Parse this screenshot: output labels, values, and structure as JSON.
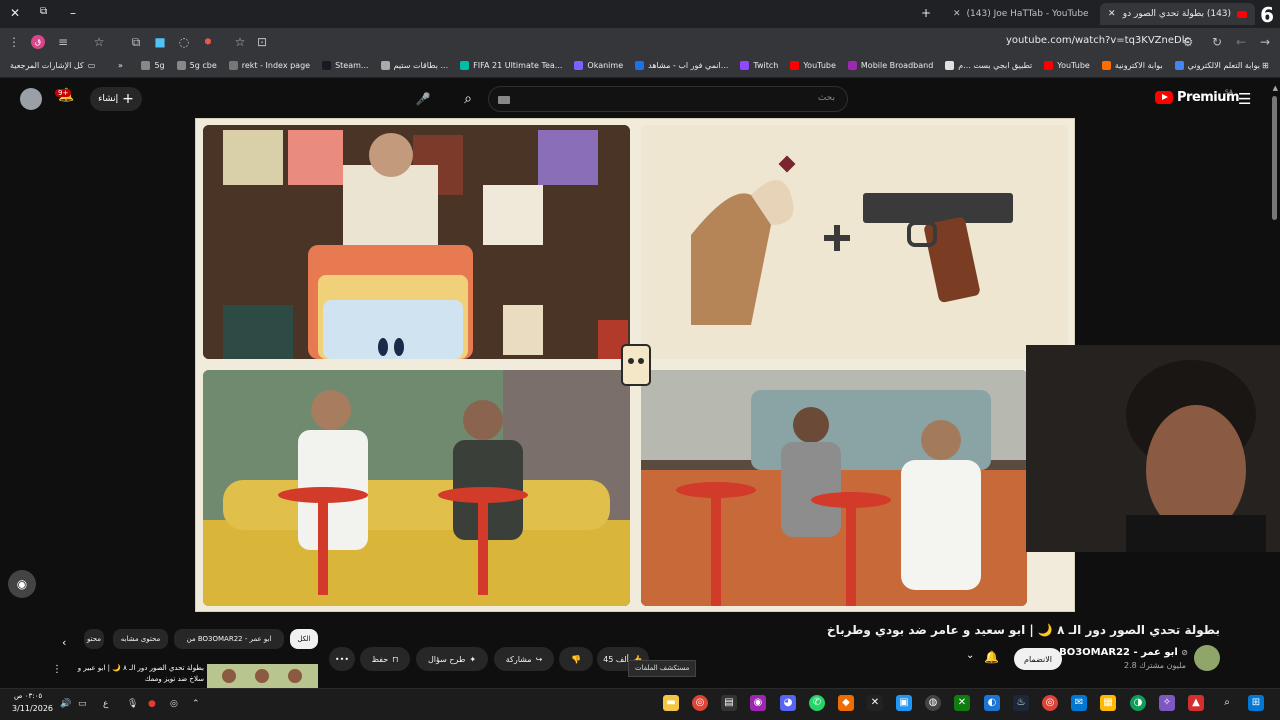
{
  "browser": {
    "tabs": [
      {
        "label": "(143) Joe HaTTab - YouTube",
        "active": false
      },
      {
        "label": "(143) بطولة تحدي الصور دو...",
        "active": true
      }
    ],
    "corner_badge": "6",
    "url": "youtube.com/watch?v=tq3KVZneDlc",
    "bookmarks": [
      {
        "label": "بوابة التعلم الالكتروني",
        "color": "#4285f4"
      },
      {
        "label": "بوابة الاكترونية",
        "color": "#ff6d00"
      },
      {
        "label": "YouTube",
        "color": "#ff0000"
      },
      {
        "label": "تطبيق ابجي بست ...م",
        "color": "#e0e0e0"
      },
      {
        "label": "Mobile Broadband",
        "color": "#9c27b0"
      },
      {
        "label": "YouTube",
        "color": "#ff0000"
      },
      {
        "label": "Twitch",
        "color": "#9146ff"
      },
      {
        "label": "انمي فور اب - مشاهد...",
        "color": "#1a73e8"
      },
      {
        "label": "Okanime",
        "color": "#7b61ff"
      },
      {
        "label": "FIFA 21 Ultimate Tea...",
        "color": "#00bfa5"
      },
      {
        "label": "بطاقات ستيم ...",
        "color": "#aaaaaa"
      },
      {
        "label": "Steam...",
        "color": "#171a21"
      },
      {
        "label": "rekt - Index page",
        "color": "#777777"
      },
      {
        "label": "5g cbe",
        "color": "#888888"
      },
      {
        "label": "5g",
        "color": "#888888"
      }
    ],
    "all_bookmarks": "كل الإشارات المرجعية"
  },
  "youtube": {
    "search_placeholder": "بحث",
    "create_label": "إنشاء",
    "notif_count": "9+",
    "logo": "Premium",
    "logo_region": "SA",
    "video_title": "بطولة تحدي الصور دور الـ ٨ 🌙 | ابو سعيد و عامر ضد بودي وطرباخ",
    "channel_name": "BO3OMAR22 - ابو عمر",
    "subscribers": "2.8 مليون مشترك",
    "join_label": "الانضمام",
    "likes": "45 ألف",
    "share_label": "مشاركة",
    "ask_label": "طرح سؤال",
    "save_label": "حفظ",
    "more_label": "•••",
    "tooltip": "مستكشف الملفات",
    "chips": [
      {
        "label": "الكل",
        "selected": true
      },
      {
        "label": "من BO3OMAR22 - ابو عمر",
        "selected": false
      },
      {
        "label": "محتوى مشابه",
        "selected": false
      },
      {
        "label": "محتو",
        "selected": false
      }
    ],
    "rec_title": "بطولة تحدي الصور دور الـ ٨ 🌙 | ابو عبير و سلاخ ضد تويز وممك"
  },
  "taskbar": {
    "time": "٠٣:٠٥ ص",
    "date": "3/11/2026",
    "lang": "ع"
  }
}
